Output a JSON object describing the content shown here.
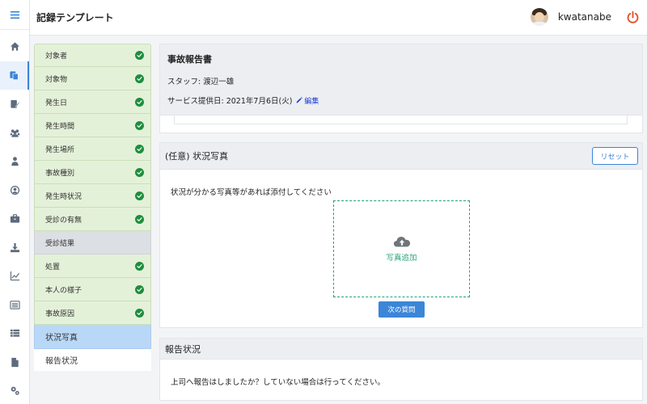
{
  "header": {
    "title": "記録テンプレート",
    "username": "kwatanabe"
  },
  "rail": {
    "icons": [
      "menu-icon",
      "home-icon",
      "copy-icon",
      "edit-document-icon",
      "users-icon",
      "person-icon",
      "user-circle-icon",
      "briefcase-icon",
      "download-icon",
      "chart-icon",
      "list-icon",
      "table-icon",
      "file-icon",
      "settings-icon"
    ],
    "active": "copy-icon"
  },
  "steps": [
    {
      "label": "対象者",
      "status": "done"
    },
    {
      "label": "対象物",
      "status": "done"
    },
    {
      "label": "発生日",
      "status": "done"
    },
    {
      "label": "発生時間",
      "status": "done"
    },
    {
      "label": "発生場所",
      "status": "done"
    },
    {
      "label": "事故種別",
      "status": "done"
    },
    {
      "label": "発生時状況",
      "status": "done"
    },
    {
      "label": "受診の有無",
      "status": "done"
    },
    {
      "label": "受診結果",
      "status": "pending"
    },
    {
      "label": "処置",
      "status": "done"
    },
    {
      "label": "本人の様子",
      "status": "done"
    },
    {
      "label": "事故原因",
      "status": "done"
    },
    {
      "label": "状況写真",
      "status": "current"
    },
    {
      "label": "報告状況",
      "status": "plain"
    }
  ],
  "report": {
    "title": "事故報告書",
    "staff": "スタッフ: 渡辺一雄",
    "service_date": "サービス提供日: 2021年7月6日(火)",
    "edit_label": "編集"
  },
  "photo_section": {
    "title": "(任意) 状況写真",
    "reset_label": "リセット",
    "prompt": "状況が分かる写真等があれば添付してください",
    "add_label": "写真追加",
    "next_label": "次の質問"
  },
  "report_status": {
    "title": "報告状況",
    "question": "上司へ報告はしましたか？していない場合は行ってください。"
  },
  "colors": {
    "accent": "#3b86d8",
    "done_bg": "#e4f1d9",
    "check": "#1e8e3e",
    "current_bg": "#b9d8f7",
    "upload": "#2aa37c",
    "power": "#e2522f"
  }
}
